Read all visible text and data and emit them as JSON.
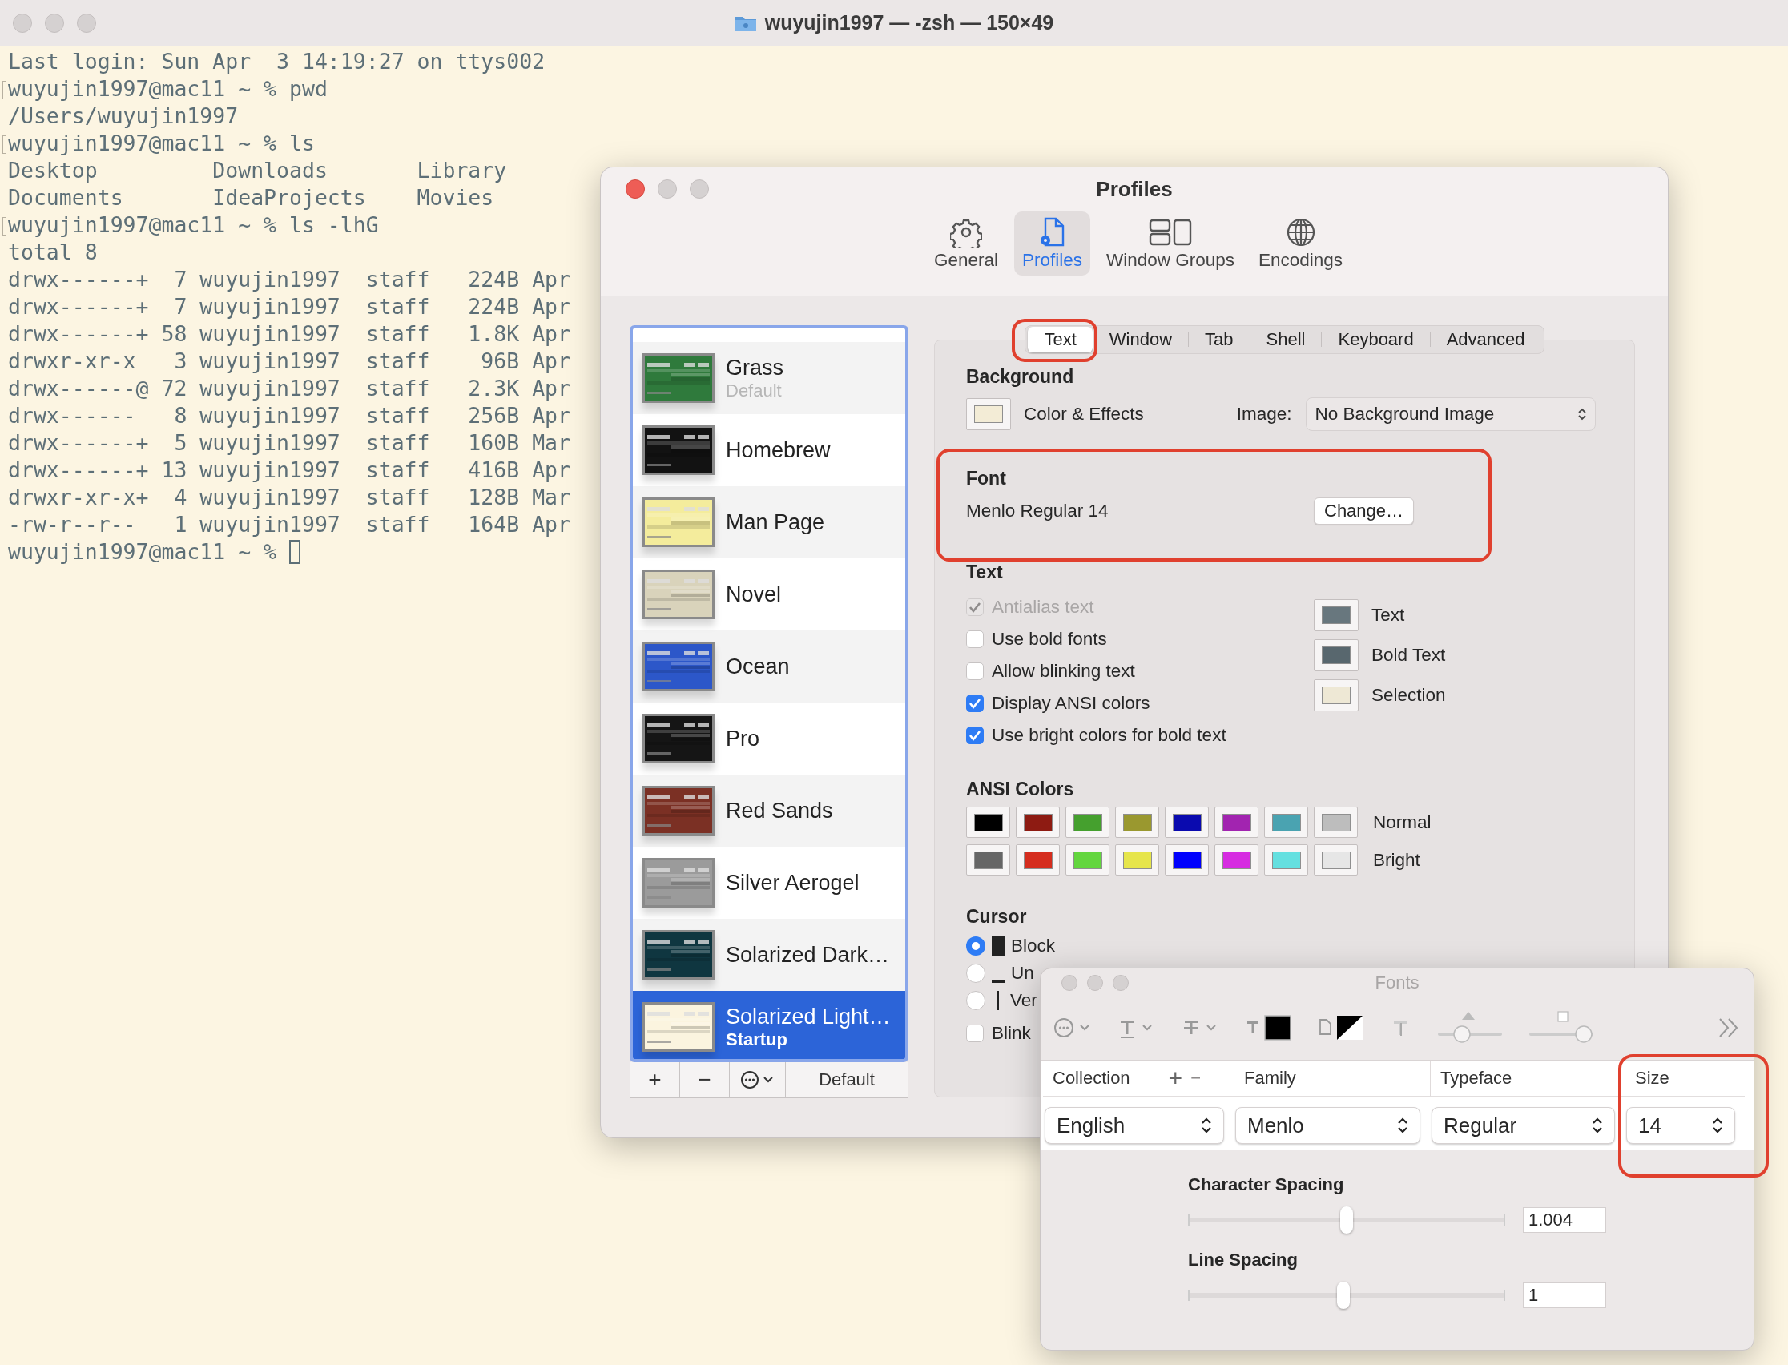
{
  "terminal": {
    "title": "wuyujin1997 — -zsh — 150×49",
    "lines": [
      {
        "text": "Last login: Sun Apr  3 14:19:27 on ttys002",
        "marked": false,
        "cursor": false
      },
      {
        "text": "wuyujin1997@mac11 ~ % pwd",
        "marked": true,
        "cursor": false
      },
      {
        "text": "/Users/wuyujin1997",
        "marked": false,
        "cursor": false
      },
      {
        "text": "wuyujin1997@mac11 ~ % ls",
        "marked": true,
        "cursor": false
      },
      {
        "text": "Desktop         Downloads       Library",
        "marked": false,
        "cursor": false
      },
      {
        "text": "Documents       IdeaProjects    Movies",
        "marked": false,
        "cursor": false
      },
      {
        "text": "wuyujin1997@mac11 ~ % ls -lhG",
        "marked": true,
        "cursor": false
      },
      {
        "text": "total 8",
        "marked": false,
        "cursor": false
      },
      {
        "text": "drwx------+  7 wuyujin1997  staff   224B Apr",
        "marked": false,
        "cursor": false
      },
      {
        "text": "drwx------+  7 wuyujin1997  staff   224B Apr",
        "marked": false,
        "cursor": false
      },
      {
        "text": "drwx------+ 58 wuyujin1997  staff   1.8K Apr",
        "marked": false,
        "cursor": false
      },
      {
        "text": "drwxr-xr-x   3 wuyujin1997  staff    96B Apr",
        "marked": false,
        "cursor": false
      },
      {
        "text": "drwx------@ 72 wuyujin1997  staff   2.3K Apr",
        "marked": false,
        "cursor": false
      },
      {
        "text": "drwx------   8 wuyujin1997  staff   256B Apr",
        "marked": false,
        "cursor": false
      },
      {
        "text": "drwx------+  5 wuyujin1997  staff   160B Mar",
        "marked": false,
        "cursor": false
      },
      {
        "text": "drwx------+ 13 wuyujin1997  staff   416B Apr",
        "marked": false,
        "cursor": false
      },
      {
        "text": "drwxr-xr-x+  4 wuyujin1997  staff   128B Mar",
        "marked": false,
        "cursor": false
      },
      {
        "text": "-rw-r--r--   1 wuyujin1997  staff   164B Apr",
        "marked": false,
        "cursor": false
      },
      {
        "text": "wuyujin1997@mac11 ~ % ",
        "marked": false,
        "cursor": true
      }
    ]
  },
  "profiles_window": {
    "title": "Profiles",
    "toolbar": [
      {
        "label": "General",
        "kind": "gear",
        "selected": false
      },
      {
        "label": "Profiles",
        "kind": "profile",
        "selected": true
      },
      {
        "label": "Window Groups",
        "kind": "groups",
        "selected": false
      },
      {
        "label": "Encodings",
        "kind": "globe",
        "selected": false
      }
    ],
    "profile_list": [
      {
        "name": "Grass",
        "tag": "Default",
        "color": "#2f7a3c",
        "selected": false
      },
      {
        "name": "Homebrew",
        "color": "#121212",
        "selected": false
      },
      {
        "name": "Man Page",
        "color": "#f4ec9c",
        "selected": false
      },
      {
        "name": "Novel",
        "color": "#d9d3bb",
        "selected": false
      },
      {
        "name": "Ocean",
        "color": "#2c57c9",
        "selected": false
      },
      {
        "name": "Pro",
        "color": "#151515",
        "selected": false
      },
      {
        "name": "Red Sands",
        "color": "#7b3024",
        "selected": false
      },
      {
        "name": "Silver Aerogel",
        "color": "#9b9b9b",
        "selected": false
      },
      {
        "name": "Solarized Dark…",
        "color": "#0f3640",
        "selected": false
      },
      {
        "name": "Solarized Light…",
        "tag": "Startup",
        "color": "#fbf4df",
        "selected": true
      }
    ],
    "list_buttons": {
      "add": "+",
      "remove": "−",
      "default": "Default"
    },
    "tabs": [
      {
        "label": "Text",
        "selected": true,
        "highlighted": true
      },
      {
        "label": "Window",
        "selected": false,
        "highlighted": false
      },
      {
        "label": "Tab",
        "selected": false,
        "highlighted": false
      },
      {
        "label": "Shell",
        "selected": false,
        "highlighted": false
      },
      {
        "label": "Keyboard",
        "selected": false,
        "highlighted": false
      },
      {
        "label": "Advanced",
        "selected": false,
        "highlighted": false
      }
    ],
    "background": {
      "heading": "Background",
      "well_label": "Color & Effects",
      "image_label": "Image:",
      "image_value": "No Background Image"
    },
    "font": {
      "heading": "Font",
      "value": "Menlo Regular 14",
      "button": "Change…",
      "highlighted": true
    },
    "text": {
      "heading": "Text",
      "options": [
        {
          "label": "Antialias text",
          "checked": true,
          "disabled": true
        },
        {
          "label": "Use bold fonts",
          "checked": false,
          "disabled": false
        },
        {
          "label": "Allow blinking text",
          "checked": false,
          "disabled": false
        },
        {
          "label": "Display ANSI colors",
          "checked": true,
          "disabled": false
        },
        {
          "label": "Use bright colors for bold text",
          "checked": true,
          "disabled": false
        }
      ],
      "wells": [
        {
          "label": "Text",
          "color": "#68777e"
        },
        {
          "label": "Bold Text",
          "color": "#58676e"
        },
        {
          "label": "Selection",
          "color": "#eee8d5"
        }
      ]
    },
    "ansi": {
      "heading": "ANSI Colors",
      "rows": [
        {
          "label": "Normal",
          "swatches": [
            {
              "color": "#000000"
            },
            {
              "color": "#8e1b12"
            },
            {
              "color": "#45a02e"
            },
            {
              "color": "#9a982f"
            },
            {
              "color": "#0a0aaf"
            },
            {
              "color": "#a224b0"
            },
            {
              "color": "#4aa3b1"
            },
            {
              "color": "#bdbdbd"
            }
          ]
        },
        {
          "label": "Bright",
          "swatches": [
            {
              "color": "#666666"
            },
            {
              "color": "#d52d1e"
            },
            {
              "color": "#63d63e"
            },
            {
              "color": "#e6e54b"
            },
            {
              "color": "#0000fd"
            },
            {
              "color": "#d62ce1"
            },
            {
              "color": "#64e0e0"
            },
            {
              "color": "#e6e6e6"
            }
          ]
        }
      ]
    },
    "cursor": {
      "heading": "Cursor",
      "options": [
        {
          "label": "Block",
          "kind": "block",
          "selected": true
        },
        {
          "label": "Un",
          "kind": "underline",
          "selected": false
        },
        {
          "label": "Ver",
          "kind": "bar",
          "selected": false
        }
      ],
      "blink": {
        "label": "Blink",
        "checked": false
      }
    }
  },
  "fonts_window": {
    "title": "Fonts",
    "add": "+",
    "remove": "−",
    "columns": [
      {
        "label": "Collection",
        "value": "English",
        "highlighted": false
      },
      {
        "label": "Family",
        "value": "Menlo",
        "highlighted": false
      },
      {
        "label": "Typeface",
        "value": "Regular",
        "highlighted": false
      },
      {
        "label": "Size",
        "value": "14",
        "highlighted": true
      }
    ],
    "spacing": [
      {
        "label": "Character Spacing",
        "level": 0.5,
        "value": "1.004"
      },
      {
        "label": "Line Spacing",
        "level": 0.49,
        "value": "1"
      }
    ]
  }
}
